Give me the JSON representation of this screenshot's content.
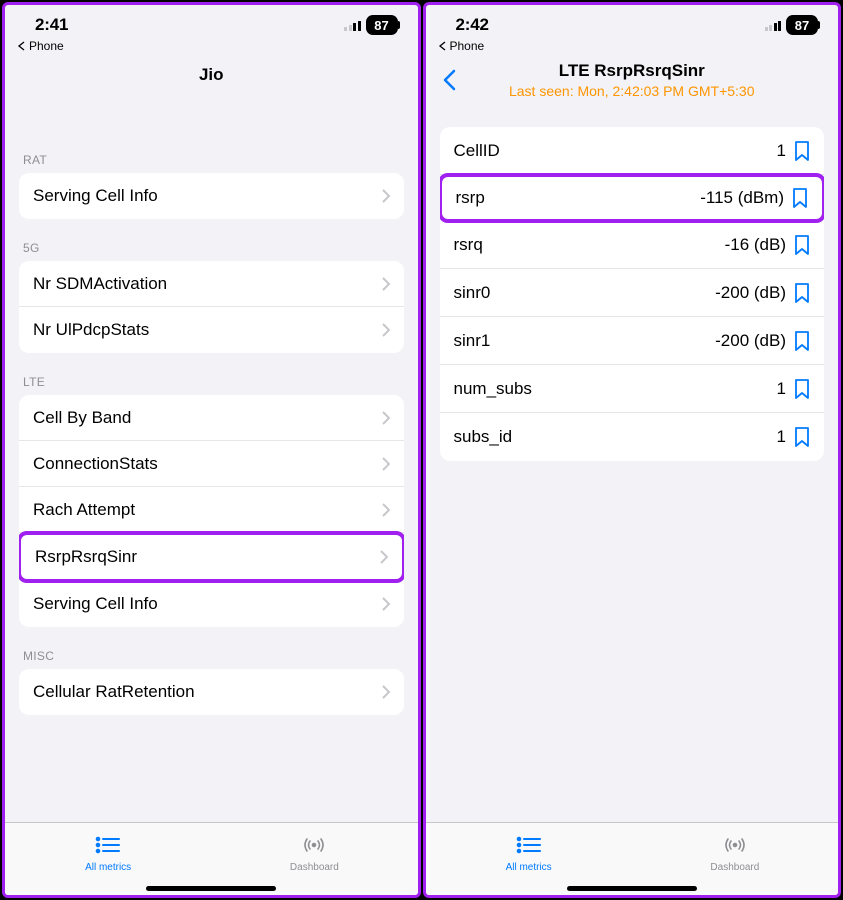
{
  "left": {
    "status": {
      "time": "2:41",
      "battery": "87"
    },
    "back_breadcrumb": "Phone",
    "title": "Jio",
    "sections": [
      {
        "header": "RAT",
        "items": [
          {
            "label": "Serving Cell Info"
          }
        ]
      },
      {
        "header": "5G",
        "items": [
          {
            "label": "Nr SDMActivation"
          },
          {
            "label": "Nr UlPdcpStats"
          }
        ]
      },
      {
        "header": "LTE",
        "items": [
          {
            "label": "Cell By Band"
          },
          {
            "label": "ConnectionStats"
          },
          {
            "label": "Rach Attempt"
          },
          {
            "label": "RsrpRsrqSinr",
            "highlighted": true
          },
          {
            "label": "Serving Cell Info"
          }
        ]
      },
      {
        "header": "MISC",
        "items": [
          {
            "label": "Cellular RatRetention"
          }
        ]
      }
    ],
    "tabs": {
      "all_metrics": "All metrics",
      "dashboard": "Dashboard"
    }
  },
  "right": {
    "status": {
      "time": "2:42",
      "battery": "87"
    },
    "back_breadcrumb": "Phone",
    "title": "LTE RsrpRsrqSinr",
    "subtitle": "Last seen: Mon, 2:42:03 PM GMT+5:30",
    "rows": [
      {
        "key": "CellID",
        "value": "1"
      },
      {
        "key": "rsrp",
        "value": "-115 (dBm)",
        "highlighted": true
      },
      {
        "key": "rsrq",
        "value": "-16 (dB)"
      },
      {
        "key": "sinr0",
        "value": "-200 (dB)"
      },
      {
        "key": "sinr1",
        "value": "-200 (dB)"
      },
      {
        "key": "num_subs",
        "value": "1"
      },
      {
        "key": "subs_id",
        "value": "1"
      }
    ],
    "tabs": {
      "all_metrics": "All metrics",
      "dashboard": "Dashboard"
    }
  }
}
